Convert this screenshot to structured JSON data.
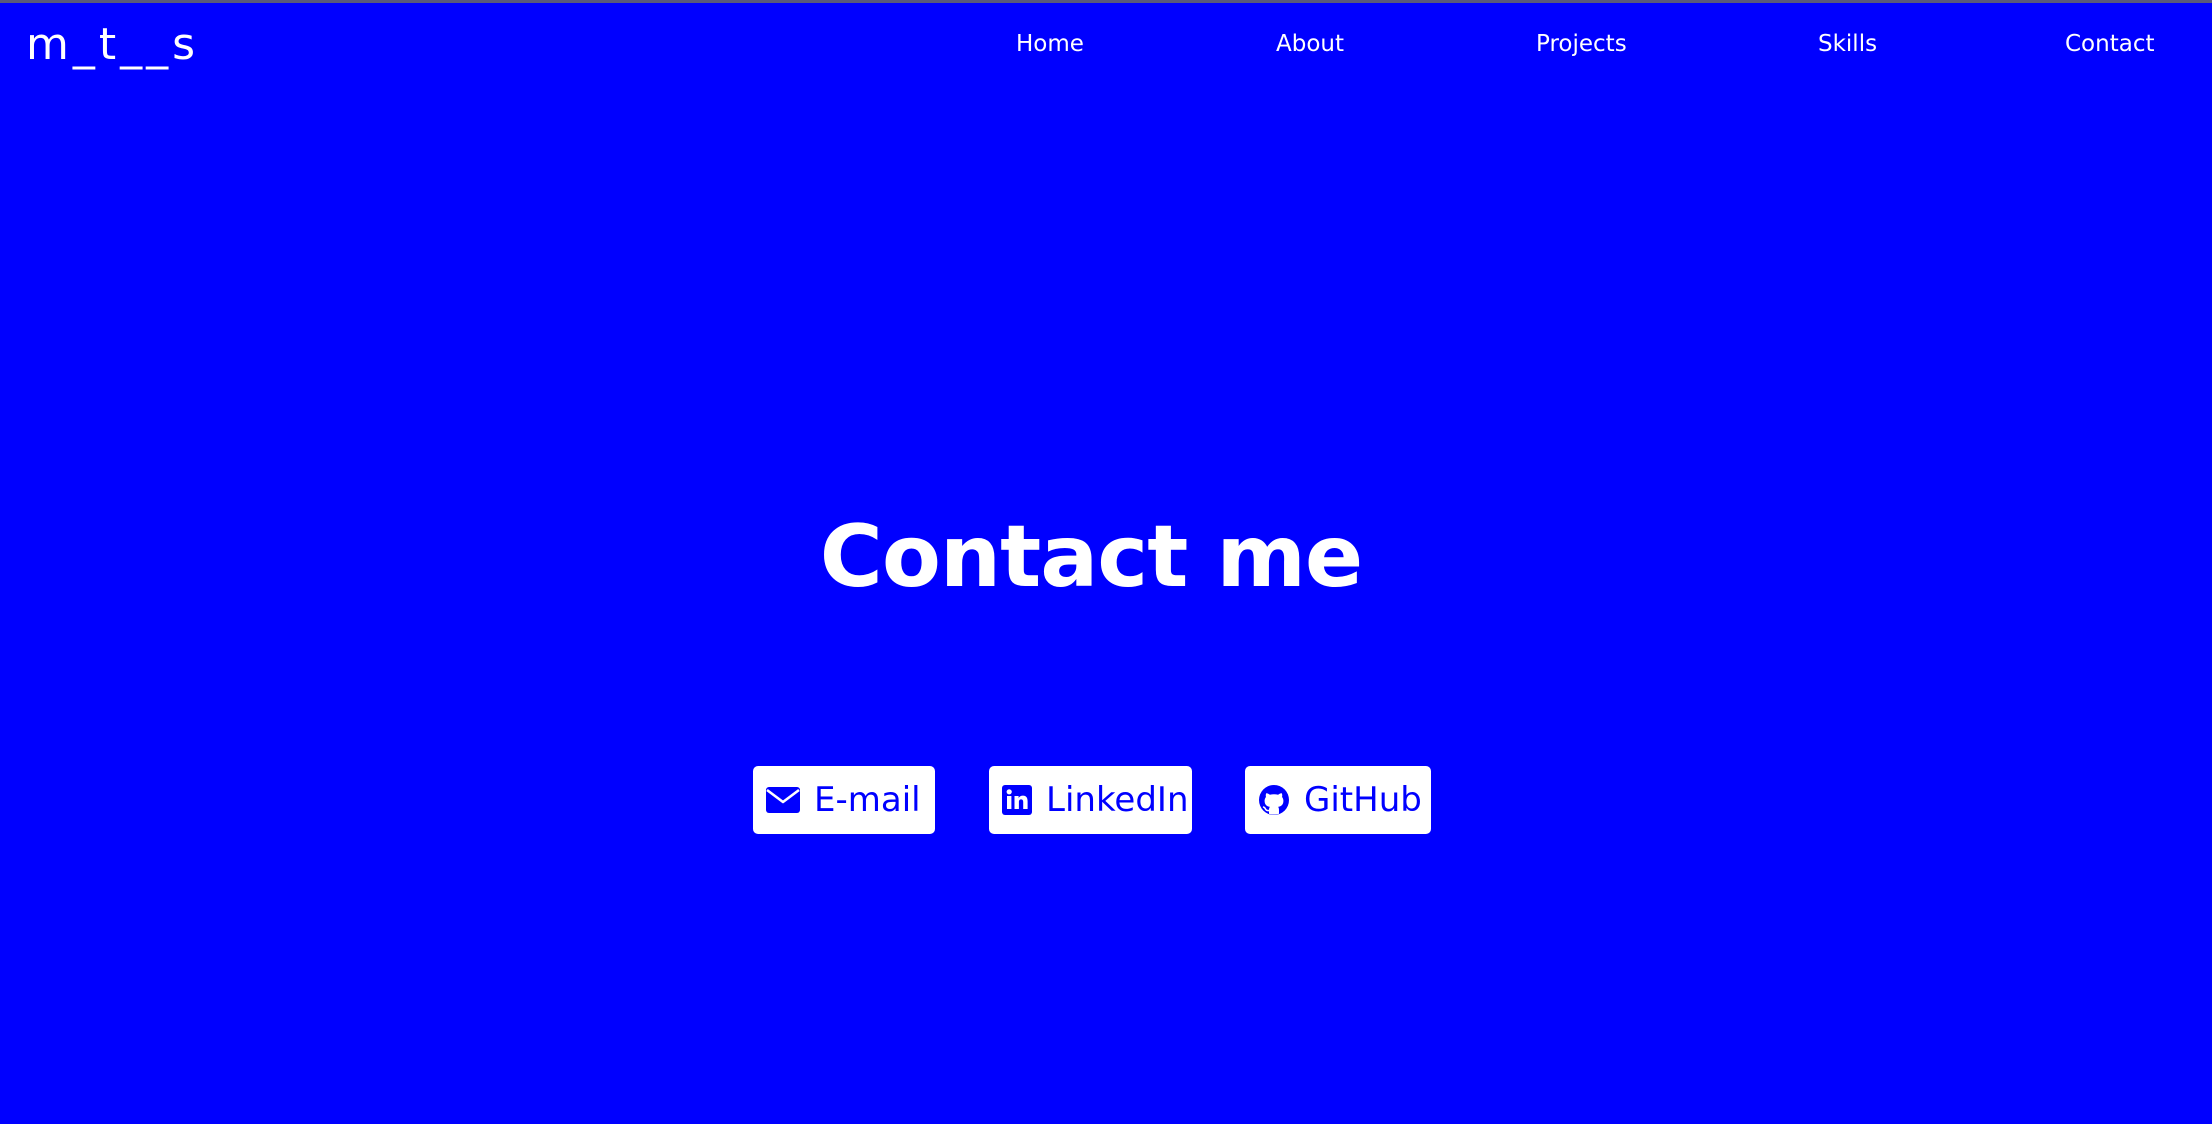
{
  "brand": {
    "logo_text": "m_t__s"
  },
  "nav": {
    "items": [
      {
        "label": "Home"
      },
      {
        "label": "About"
      },
      {
        "label": "Projects"
      },
      {
        "label": "Skills"
      },
      {
        "label": "Contact"
      }
    ]
  },
  "contact": {
    "heading": "Contact me",
    "links": [
      {
        "label": "E-mail",
        "icon": "envelope-icon"
      },
      {
        "label": "LinkedIn",
        "icon": "linkedin-icon"
      },
      {
        "label": "GitHub",
        "icon": "github-icon"
      }
    ]
  },
  "colors": {
    "background": "#0000ff",
    "text": "#ffffff",
    "button_background": "#ffffff",
    "button_text": "#0000ff"
  }
}
